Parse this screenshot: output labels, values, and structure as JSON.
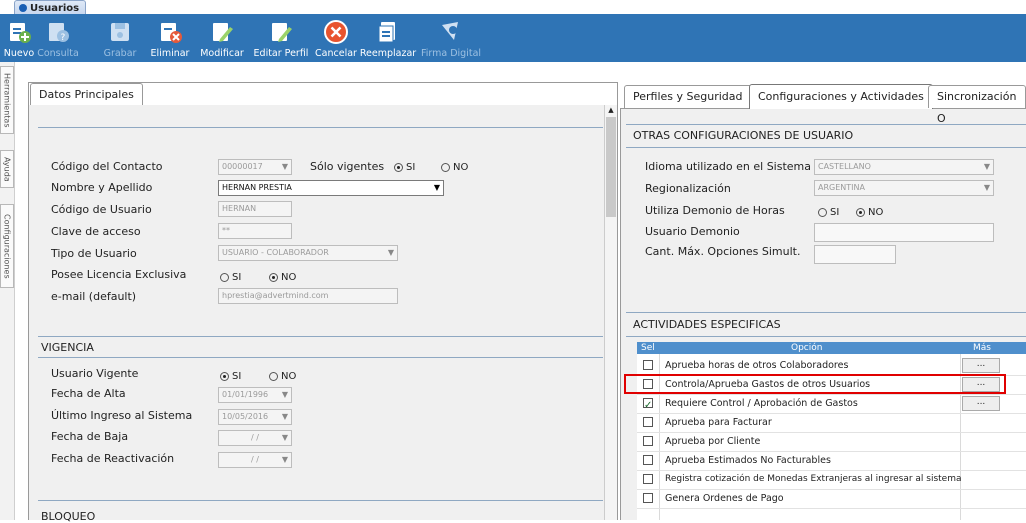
{
  "window_tab": {
    "title": "Usuarios"
  },
  "toolbar": {
    "items": [
      {
        "label": "Nuevo",
        "enabled": true
      },
      {
        "label": "Consulta",
        "enabled": false
      },
      {
        "label": "Grabar",
        "enabled": false
      },
      {
        "label": "Eliminar",
        "enabled": true
      },
      {
        "label": "Modificar",
        "enabled": true
      },
      {
        "label": "Editar Perfil",
        "enabled": true
      },
      {
        "label": "Cancelar",
        "enabled": true
      },
      {
        "label": "Reemplazar",
        "enabled": true
      },
      {
        "label": "Firma Digital",
        "enabled": false
      }
    ]
  },
  "side_rail": {
    "tabs": [
      "Herramientas",
      "Ayuda",
      "Configuraciones"
    ]
  },
  "left": {
    "tab_label": "Datos Principales",
    "fields": {
      "codigo_contacto": {
        "label": "Código del Contacto",
        "value": "00000017"
      },
      "solo_vigentes": {
        "label": "Sólo vigentes",
        "options": [
          "SI",
          "NO"
        ],
        "selected": "SI"
      },
      "nombre_apellido": {
        "label": "Nombre y Apellido",
        "value": "HERNAN PRESTIA"
      },
      "codigo_usuario": {
        "label": "Código de Usuario",
        "value": "HERNAN"
      },
      "clave_acceso": {
        "label": "Clave de acceso",
        "value": "**"
      },
      "tipo_usuario": {
        "label": "Tipo de Usuario",
        "value": "USUARIO - COLABORADOR"
      },
      "licencia": {
        "label": "Posee Licencia Exclusiva",
        "options": [
          "SI",
          "NO"
        ],
        "selected": "NO"
      },
      "email": {
        "label": "e-mail (default)",
        "value": "hprestia@advertmind.com"
      }
    },
    "vigencia": {
      "title": "VIGENCIA",
      "usuario_vigente": {
        "label": "Usuario Vigente",
        "options": [
          "SI",
          "NO"
        ],
        "selected": "SI"
      },
      "fecha_alta": {
        "label": "Fecha de Alta",
        "value": "01/01/1996"
      },
      "ultimo_ingreso": {
        "label": "Último Ingreso al Sistema",
        "value": "10/05/2016"
      },
      "fecha_baja": {
        "label": "Fecha de Baja",
        "value": "/ /"
      },
      "fecha_reactivacion": {
        "label": "Fecha de Reactivación",
        "value": "/ /"
      }
    },
    "bloqueo": {
      "title": "BLOQUEO"
    }
  },
  "right": {
    "tabs": [
      "Perfiles y Seguridad",
      "Configuraciones y Actividades",
      "Sincronización O"
    ],
    "active_tab": "Configuraciones y Actividades",
    "otras": {
      "title": "OTRAS CONFIGURACIONES DE USUARIO",
      "idioma": {
        "label": "Idioma utilizado en el Sistema",
        "value": "CASTELLANO"
      },
      "regionalizacion": {
        "label": "Regionalización",
        "value": "ARGENTINA"
      },
      "demonio_horas": {
        "label": "Utiliza Demonio de Horas",
        "options": [
          "SI",
          "NO"
        ],
        "selected": "NO"
      },
      "usuario_demonio": {
        "label": "Usuario Demonio",
        "value": ""
      },
      "cant_max": {
        "label": "Cant. Máx. Opciones Simult.",
        "value": ""
      }
    },
    "actividades": {
      "title": "ACTIVIDADES ESPECIFICAS",
      "columns": {
        "sel": "Sel",
        "opcion": "Opción",
        "mas": "Más"
      },
      "rows": [
        {
          "option": "Aprueba horas de otros Colaboradores",
          "selected": false,
          "more": "...",
          "highlighted": false
        },
        {
          "option": "Controla/Aprueba Gastos de otros Usuarios",
          "selected": false,
          "more": "...",
          "highlighted": true
        },
        {
          "option": "Requiere Control / Aprobación de Gastos",
          "selected": true,
          "more": "...",
          "highlighted": false
        },
        {
          "option": "Aprueba para Facturar",
          "selected": false,
          "more": "",
          "highlighted": false
        },
        {
          "option": "Aprueba por Cliente",
          "selected": false,
          "more": "",
          "highlighted": false
        },
        {
          "option": "Aprueba Estimados No Facturables",
          "selected": false,
          "more": "",
          "highlighted": false
        },
        {
          "option": "Registra cotización de Monedas Extranjeras al ingresar al sistema",
          "selected": false,
          "more": "",
          "highlighted": false
        },
        {
          "option": "Genera Ordenes de Pago",
          "selected": false,
          "more": "",
          "highlighted": false
        }
      ]
    }
  },
  "colors": {
    "toolbar": "#2f74b5",
    "grid_header": "#4f8fcc",
    "highlight": "#e00000"
  }
}
